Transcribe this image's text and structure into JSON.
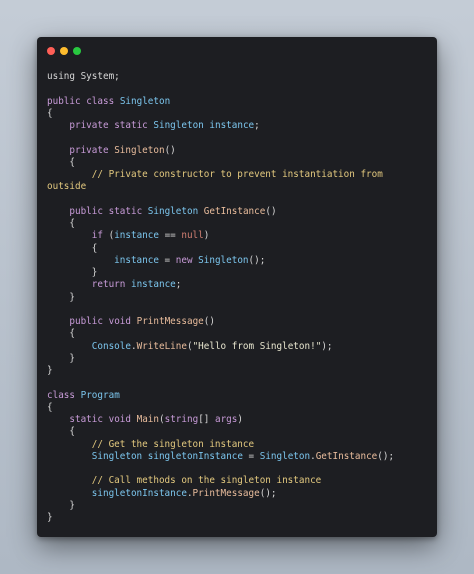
{
  "window": {
    "controls": {
      "close_color": "#ff5f57",
      "minimize_color": "#febc2e",
      "maximize_color": "#28c840"
    }
  },
  "colors": {
    "background": "#1d1e22",
    "keyword": "#c89bd8",
    "type": "#7cc6ee",
    "function": "#e8bc9c",
    "comment": "#e3c97f",
    "string": "#e8e6cf",
    "null": "#d07f72",
    "plain": "#d7d7d7"
  },
  "code": {
    "language": "C#",
    "lines": [
      [
        {
          "t": "plain",
          "v": "using System;"
        }
      ],
      [],
      [
        {
          "t": "kw",
          "v": "public"
        },
        {
          "t": "plain",
          "v": " "
        },
        {
          "t": "kw",
          "v": "class"
        },
        {
          "t": "plain",
          "v": " "
        },
        {
          "t": "type",
          "v": "Singleton"
        }
      ],
      [
        {
          "t": "plain",
          "v": "{"
        }
      ],
      [
        {
          "t": "plain",
          "v": "    "
        },
        {
          "t": "kw",
          "v": "private"
        },
        {
          "t": "plain",
          "v": " "
        },
        {
          "t": "kw",
          "v": "static"
        },
        {
          "t": "plain",
          "v": " "
        },
        {
          "t": "type",
          "v": "Singleton"
        },
        {
          "t": "plain",
          "v": " "
        },
        {
          "t": "type",
          "v": "instance"
        },
        {
          "t": "plain",
          "v": ";"
        }
      ],
      [],
      [
        {
          "t": "plain",
          "v": "    "
        },
        {
          "t": "kw",
          "v": "private"
        },
        {
          "t": "plain",
          "v": " "
        },
        {
          "t": "fn",
          "v": "Singleton"
        },
        {
          "t": "plain",
          "v": "()"
        }
      ],
      [
        {
          "t": "plain",
          "v": "    {"
        }
      ],
      [
        {
          "t": "plain",
          "v": "        "
        },
        {
          "t": "comment",
          "v": "// Private constructor to prevent instantiation from"
        }
      ],
      [
        {
          "t": "comment",
          "v": "outside"
        }
      ],
      [],
      [
        {
          "t": "plain",
          "v": "    "
        },
        {
          "t": "kw",
          "v": "public"
        },
        {
          "t": "plain",
          "v": " "
        },
        {
          "t": "kw",
          "v": "static"
        },
        {
          "t": "plain",
          "v": " "
        },
        {
          "t": "type",
          "v": "Singleton"
        },
        {
          "t": "plain",
          "v": " "
        },
        {
          "t": "fn",
          "v": "GetInstance"
        },
        {
          "t": "plain",
          "v": "()"
        }
      ],
      [
        {
          "t": "plain",
          "v": "    {"
        }
      ],
      [
        {
          "t": "plain",
          "v": "        "
        },
        {
          "t": "kw",
          "v": "if"
        },
        {
          "t": "plain",
          "v": " ("
        },
        {
          "t": "type",
          "v": "instance"
        },
        {
          "t": "plain",
          "v": " == "
        },
        {
          "t": "null",
          "v": "null"
        },
        {
          "t": "plain",
          "v": ")"
        }
      ],
      [
        {
          "t": "plain",
          "v": "        {"
        }
      ],
      [
        {
          "t": "plain",
          "v": "            "
        },
        {
          "t": "type",
          "v": "instance"
        },
        {
          "t": "plain",
          "v": " = "
        },
        {
          "t": "kw",
          "v": "new"
        },
        {
          "t": "plain",
          "v": " "
        },
        {
          "t": "type",
          "v": "Singleton"
        },
        {
          "t": "plain",
          "v": "();"
        }
      ],
      [
        {
          "t": "plain",
          "v": "        }"
        }
      ],
      [
        {
          "t": "plain",
          "v": "        "
        },
        {
          "t": "kw",
          "v": "return"
        },
        {
          "t": "plain",
          "v": " "
        },
        {
          "t": "type",
          "v": "instance"
        },
        {
          "t": "plain",
          "v": ";"
        }
      ],
      [
        {
          "t": "plain",
          "v": "    }"
        }
      ],
      [],
      [
        {
          "t": "plain",
          "v": "    "
        },
        {
          "t": "kw",
          "v": "public"
        },
        {
          "t": "plain",
          "v": " "
        },
        {
          "t": "kw",
          "v": "void"
        },
        {
          "t": "plain",
          "v": " "
        },
        {
          "t": "fn",
          "v": "PrintMessage"
        },
        {
          "t": "plain",
          "v": "()"
        }
      ],
      [
        {
          "t": "plain",
          "v": "    {"
        }
      ],
      [
        {
          "t": "plain",
          "v": "        "
        },
        {
          "t": "type",
          "v": "Console"
        },
        {
          "t": "plain",
          "v": "."
        },
        {
          "t": "fn",
          "v": "WriteLine"
        },
        {
          "t": "plain",
          "v": "("
        },
        {
          "t": "string",
          "v": "\"Hello from Singleton!\""
        },
        {
          "t": "plain",
          "v": ");"
        }
      ],
      [
        {
          "t": "plain",
          "v": "    }"
        }
      ],
      [
        {
          "t": "plain",
          "v": "}"
        }
      ],
      [],
      [
        {
          "t": "kw",
          "v": "class"
        },
        {
          "t": "plain",
          "v": " "
        },
        {
          "t": "type",
          "v": "Program"
        }
      ],
      [
        {
          "t": "plain",
          "v": "{"
        }
      ],
      [
        {
          "t": "plain",
          "v": "    "
        },
        {
          "t": "kw",
          "v": "static"
        },
        {
          "t": "plain",
          "v": " "
        },
        {
          "t": "kw",
          "v": "void"
        },
        {
          "t": "plain",
          "v": " "
        },
        {
          "t": "fn",
          "v": "Main"
        },
        {
          "t": "plain",
          "v": "("
        },
        {
          "t": "kw",
          "v": "string"
        },
        {
          "t": "plain",
          "v": "[] "
        },
        {
          "t": "kw",
          "v": "args"
        },
        {
          "t": "plain",
          "v": ")"
        }
      ],
      [
        {
          "t": "plain",
          "v": "    {"
        }
      ],
      [
        {
          "t": "plain",
          "v": "        "
        },
        {
          "t": "comment",
          "v": "// Get the singleton instance"
        }
      ],
      [
        {
          "t": "plain",
          "v": "        "
        },
        {
          "t": "type",
          "v": "Singleton"
        },
        {
          "t": "plain",
          "v": " "
        },
        {
          "t": "type",
          "v": "singletonInstance"
        },
        {
          "t": "plain",
          "v": " = "
        },
        {
          "t": "type",
          "v": "Singleton"
        },
        {
          "t": "plain",
          "v": "."
        },
        {
          "t": "fn",
          "v": "GetInstance"
        },
        {
          "t": "plain",
          "v": "();"
        }
      ],
      [],
      [
        {
          "t": "plain",
          "v": "        "
        },
        {
          "t": "comment",
          "v": "// Call methods on the singleton instance"
        }
      ],
      [
        {
          "t": "plain",
          "v": "        "
        },
        {
          "t": "type",
          "v": "singletonInstance"
        },
        {
          "t": "plain",
          "v": "."
        },
        {
          "t": "fn",
          "v": "PrintMessage"
        },
        {
          "t": "plain",
          "v": "();"
        }
      ],
      [
        {
          "t": "plain",
          "v": "    }"
        }
      ],
      [
        {
          "t": "plain",
          "v": "}"
        }
      ]
    ]
  }
}
